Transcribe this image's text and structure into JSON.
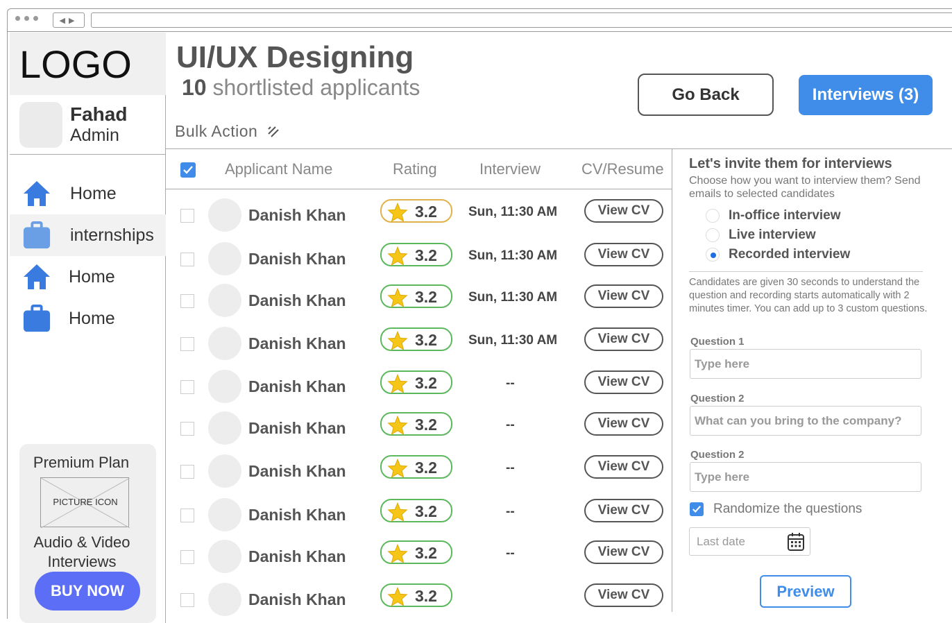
{
  "sidebar": {
    "logo": "LOGO",
    "user": {
      "name": "Fahad",
      "role": "Admin"
    },
    "items": [
      {
        "label": "Home",
        "icon": "home-icon",
        "color": "#3a7be0"
      },
      {
        "label": "internships",
        "icon": "briefcase-icon",
        "color": "#6a9fe6",
        "active": true
      },
      {
        "label": "Home",
        "icon": "home-icon",
        "color": "#3a7be0"
      },
      {
        "label": "Home",
        "icon": "briefcase-icon",
        "color": "#3a7be0"
      }
    ],
    "premium": {
      "title": "Premium Plan",
      "picture_label": "PICTURE ICON",
      "description": "Audio & Video Interviews",
      "button": "BUY NOW"
    }
  },
  "header": {
    "title": "UI/UX Designing",
    "count": "10",
    "subtitle": "shortlisted applicants",
    "go_back": "Go Back",
    "interviews": "Interviews (3)",
    "bulk_action": "Bulk Action"
  },
  "table": {
    "columns": [
      "Applicant Name",
      "Rating",
      "Interview",
      "CV/Resume"
    ],
    "rows": [
      {
        "name": "Danish Khan",
        "rating": "3.2",
        "interview": "Sun, 11:30 AM",
        "cv": "View CV",
        "highlight": true
      },
      {
        "name": "Danish Khan",
        "rating": "3.2",
        "interview": "Sun, 11:30 AM",
        "cv": "View CV"
      },
      {
        "name": "Danish Khan",
        "rating": "3.2",
        "interview": "Sun, 11:30 AM",
        "cv": "View CV"
      },
      {
        "name": "Danish Khan",
        "rating": "3.2",
        "interview": "Sun, 11:30 AM",
        "cv": "View CV"
      },
      {
        "name": "Danish Khan",
        "rating": "3.2",
        "interview": "--",
        "cv": "View CV"
      },
      {
        "name": "Danish Khan",
        "rating": "3.2",
        "interview": "--",
        "cv": "View CV"
      },
      {
        "name": "Danish Khan",
        "rating": "3.2",
        "interview": "--",
        "cv": "View CV"
      },
      {
        "name": "Danish Khan",
        "rating": "3.2",
        "interview": "--",
        "cv": "View CV"
      },
      {
        "name": "Danish Khan",
        "rating": "3.2",
        "interview": "--",
        "cv": "View CV"
      },
      {
        "name": "Danish Khan",
        "rating": "3.2",
        "interview": "",
        "cv": "View CV"
      }
    ]
  },
  "panel": {
    "title": "Let's invite them for interviews",
    "description": "Choose how you want to interview them? Send emails to selected candidates",
    "options": [
      {
        "label": "In-office interview",
        "checked": false
      },
      {
        "label": "Live interview",
        "checked": false
      },
      {
        "label": "Recorded interview",
        "checked": true
      }
    ],
    "note": "Candidates are given 30 seconds to understand the question and recording starts automatically with 2 minutes timer. You can add up to 3 custom questions.",
    "questions": [
      {
        "label": "Question 1",
        "placeholder": "Type here"
      },
      {
        "label": "Question 2",
        "placeholder": "What can you bring to the company?"
      },
      {
        "label": "Question 2",
        "placeholder": "Type here"
      }
    ],
    "randomize": "Randomize the questions",
    "last_date": "Last date",
    "preview": "Preview"
  },
  "colors": {
    "primary": "#3f8de8",
    "buy_button": "#5b6ef5",
    "rating_border": "#5cb85c",
    "rating_border_first": "#e0b24a",
    "star": "#f5c518"
  }
}
